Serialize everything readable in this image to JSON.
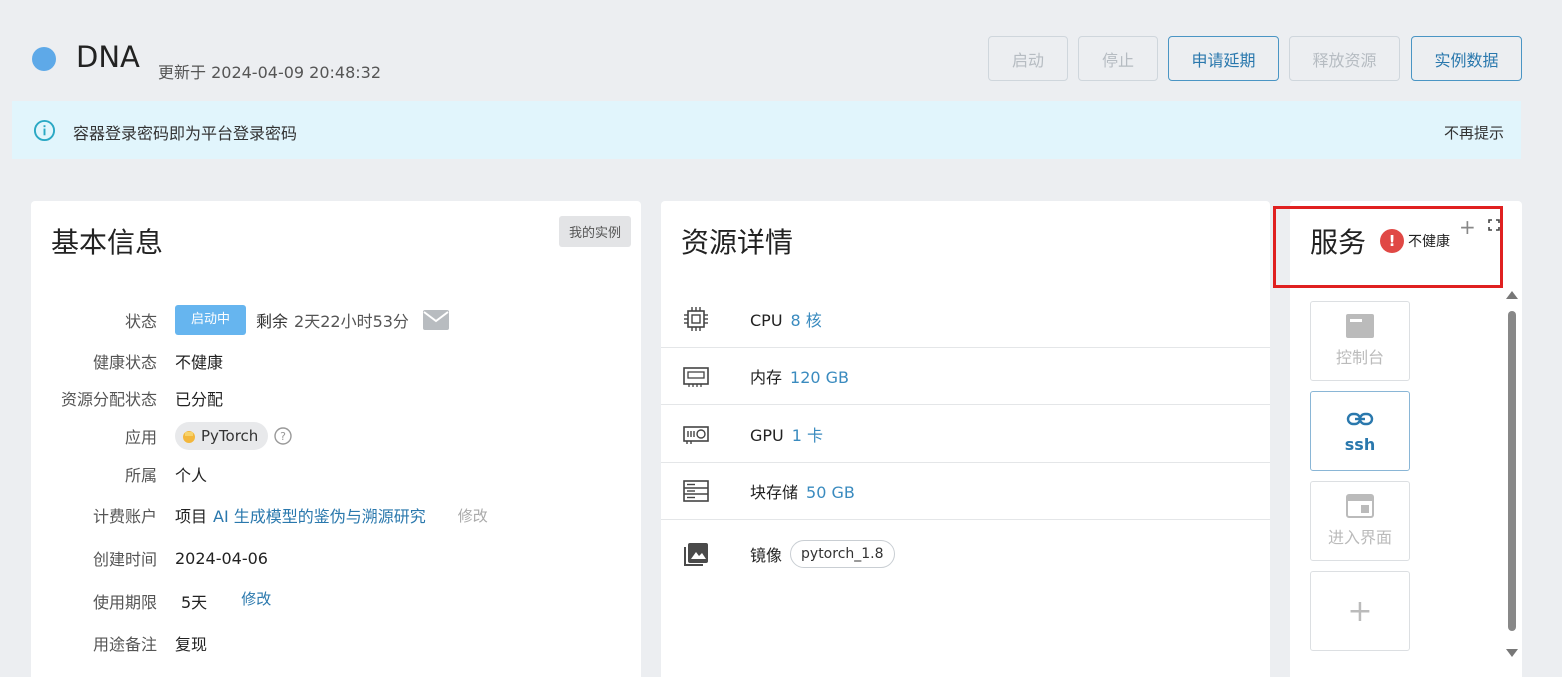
{
  "header": {
    "title": "DNA",
    "updated": "更新于 2024-04-09 20:48:32",
    "buttons": [
      {
        "label": "启动",
        "enabled": false
      },
      {
        "label": "停止",
        "enabled": false
      },
      {
        "label": "申请延期",
        "enabled": true
      },
      {
        "label": "释放资源",
        "enabled": false
      },
      {
        "label": "实例数据",
        "enabled": true
      }
    ]
  },
  "notice": {
    "text": "容器登录密码即为平台登录密码",
    "dismiss": "不再提示"
  },
  "basic": {
    "title": "基本信息",
    "tag": "我的实例",
    "status_label": "状态",
    "status_badge": "启动中",
    "remain_label": "剩余",
    "remain_value": "2天22小时53分",
    "health_label": "健康状态",
    "health_value": "不健康",
    "alloc_label": "资源分配状态",
    "alloc_value": "已分配",
    "app_label": "应用",
    "app_value": "PyTorch",
    "owner_label": "所属",
    "owner_value": "个人",
    "billing_label": "计费账户",
    "billing_prefix": "项目",
    "billing_project": "AI 生成模型的鉴伪与溯源研究",
    "billing_edit": "修改",
    "created_label": "创建时间",
    "created_value": "2024-04-06",
    "period_label": "使用期限",
    "period_value": "5天",
    "period_edit": "修改",
    "note_label": "用途备注",
    "note_value": "复现"
  },
  "resources": {
    "title": "资源详情",
    "cpu_label": "CPU",
    "cpu_value": "8 核",
    "mem_label": "内存",
    "mem_value": "120 GB",
    "gpu_label": "GPU",
    "gpu_value": "1 卡",
    "storage_label": "块存储",
    "storage_value": "50 GB",
    "image_label": "镜像",
    "image_value": "pytorch_1.8"
  },
  "services": {
    "title": "服务",
    "health": "不健康",
    "plus": "+",
    "tiles": [
      {
        "label": "控制台",
        "enabled": false
      },
      {
        "label": "ssh",
        "enabled": true
      },
      {
        "label": "进入界面",
        "enabled": false
      },
      {
        "label": "+",
        "enabled": false
      }
    ]
  },
  "colors": {
    "accent": "#2a78ad",
    "status_dot": "#5ea9e8",
    "badge": "#66b5ef",
    "error": "#e04845",
    "notice_bg": "#e1f5fc"
  }
}
